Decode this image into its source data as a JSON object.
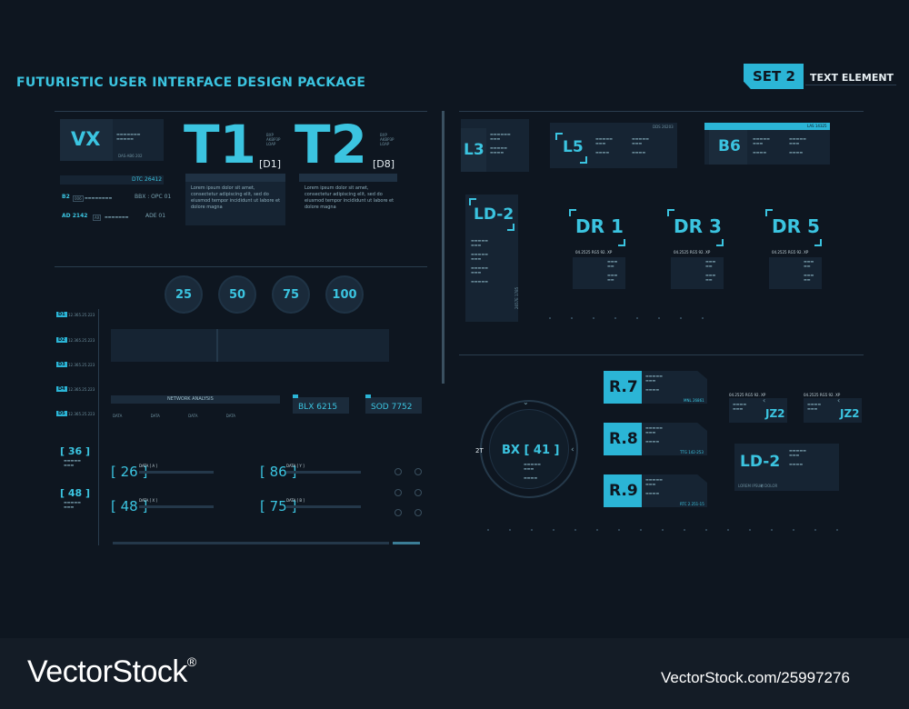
{
  "header": {
    "title": "FUTURISTIC USER INTERFACE DESIGN PACKAGE",
    "set_label": "SET 2",
    "set_caption": "TEXT ELEMENT"
  },
  "left": {
    "vx": "VX",
    "vx_code": "DAS-AB6 202",
    "dtc": "DTC 26412",
    "b2": "B2",
    "b2_tag": "006",
    "bbx": "BBX : OPC 01",
    "ad": "AD 2142",
    "ad_tag": "AX",
    "ade": "ADE 01",
    "t1": "T1",
    "t2": "T2",
    "d1": "[D1]",
    "d8": "[D8]",
    "bxp_lines": [
      "BXP",
      "AKBP3P",
      "LOAP"
    ],
    "code_line": "12.365.25.223",
    "lorem": "Lorem ipsum dolor sit amet, consectetur adipiscing elit, sed do eiusmod tempor incididunt ut labore et dolore magna",
    "lorem2": "Lorem ipsum dolor sit amet, consectetur adipiscing elit, sed do eiusmod tempor incididunt ut labore et dolore magna",
    "circles": [
      "25",
      "50",
      "75",
      "100"
    ],
    "tags": [
      "D1",
      "D2",
      "D3",
      "D4",
      "D5"
    ],
    "tag_code": "12.365.25.223",
    "bracket_36": "[ 36 ]",
    "bracket_48": "[ 48 ]",
    "network": "NETWORK ANALYSIS",
    "blx": "BLX 6215",
    "sod": "SOD 7752",
    "data_rows": [
      {
        "num": "[ 26 ]",
        "label": "DATA [ A ]"
      },
      {
        "num": "[ 86 ]",
        "label": "DATA [ Y ]"
      },
      {
        "num": "[ 48 ]",
        "label": "DATA [ X ]"
      },
      {
        "num": "[ 75 ]",
        "label": "DATA [ B ]"
      }
    ]
  },
  "right": {
    "l3": "L3",
    "l5": "L5",
    "l5_code": "DDS 26203",
    "b6": "B6",
    "b6_code": "LAS 14325",
    "ld2": "LD-2",
    "dr1": "DR 1",
    "dr3": "DR 3",
    "dr5": "DR 5",
    "dr_code": "04.2525 RG5 92. XP",
    "r7": "R.7",
    "r7_code": "MNL 26861",
    "r8": "R.8",
    "r8_code": "TTG 142-253",
    "r9": "R.9",
    "r9_code": "RTC 2.251-15",
    "bx41": "BX [ 41 ]",
    "two_t": "2T",
    "jz2": "JZ2",
    "jz2b": "JZ2",
    "jz_code": "04.2525 RG5 92. XP",
    "ld2b": "LD-2",
    "lorem_short": "LOREM IPSUM DOLOR",
    "side_code": "2657E 1785"
  },
  "footer": {
    "brand": "VectorStock",
    "reg": "®",
    "url": "VectorStock.com/25997276"
  }
}
